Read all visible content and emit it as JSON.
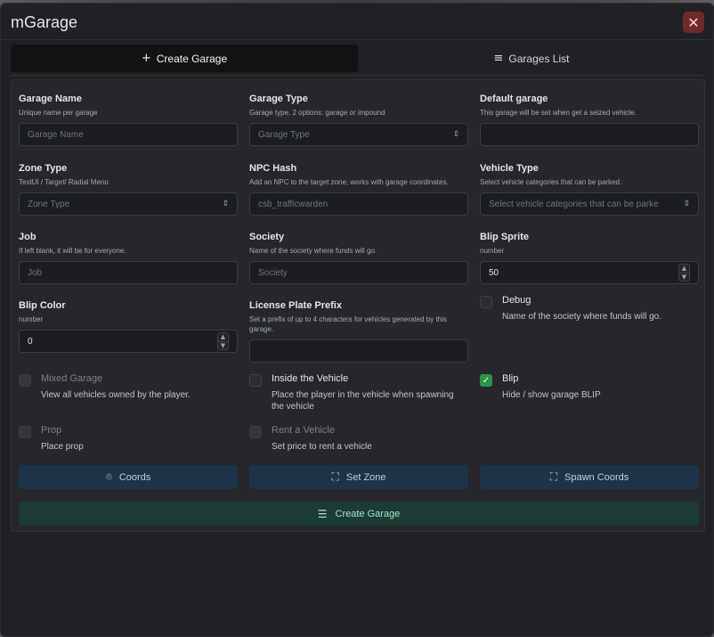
{
  "app": {
    "title": "mGarage",
    "close_icon": "✕"
  },
  "tabs": [
    {
      "label": "Create Garage",
      "icon": "+"
    },
    {
      "label": "Garages List",
      "icon": "≡"
    }
  ],
  "form": {
    "garage_name": {
      "label": "Garage Name",
      "desc": "Unique name per garage",
      "placeholder": "Garage Name"
    },
    "garage_type": {
      "label": "Garage Type",
      "desc": "Garage type, 2 options: garage or impound",
      "placeholder": "Garage Type"
    },
    "default_garage": {
      "label": "Default garage",
      "desc": "This garage will be set when get a seized vehicle.",
      "value": ""
    },
    "zone_type": {
      "label": "Zone Type",
      "desc": "TextUI / Target/ Radial Menu",
      "placeholder": "Zone Type"
    },
    "npc_hash": {
      "label": "NPC Hash",
      "desc": "Add an NPC to the target zone, works with garage coordinates.",
      "placeholder": "csb_trafficwarden"
    },
    "vehicle_type": {
      "label": "Vehicle Type",
      "desc": "Select vehicle categories that can be parked.",
      "placeholder": "Select vehicle categories that can be parke"
    },
    "job": {
      "label": "Job",
      "desc": "If left blank, it will be for everyone.",
      "placeholder": "Job"
    },
    "society": {
      "label": "Society",
      "desc": "Name of the society where funds will go.",
      "placeholder": "Society"
    },
    "blip_sprite": {
      "label": "Blip Sprite",
      "desc": "number",
      "value": "50"
    },
    "blip_color": {
      "label": "Blip Color",
      "desc": "number",
      "value": "0"
    },
    "plate_prefix": {
      "label": "License Plate Prefix",
      "desc": "Set a prefix of up to 4 characters for vehicles generated by this garage.",
      "value": ""
    }
  },
  "checks": {
    "debug": {
      "label": "Debug",
      "desc": "Name of the society where funds will go.",
      "checked": false
    },
    "mixed_garage": {
      "label": "Mixed Garage",
      "desc": "View all vehicles owned by the player.",
      "checked": false
    },
    "inside_vehicle": {
      "label": "Inside the Vehicle",
      "desc": "Place the player in the vehicle when spawning the vehicle",
      "checked": false
    },
    "blip": {
      "label": "Blip",
      "desc": "Hide / show garage BLIP",
      "checked": true
    },
    "prop": {
      "label": "Prop",
      "desc": "Place prop",
      "checked": false
    },
    "rent_vehicle": {
      "label": "Rent a Vehicle",
      "desc": "Set price to rent a vehicle",
      "checked": false
    }
  },
  "actions": {
    "coords": "Coords",
    "set_zone": "Set Zone",
    "spawn_coords": "Spawn Coords",
    "create": "Create Garage"
  },
  "colors": {
    "accent_blue": "#1d3348",
    "accent_green": "#1b3b34",
    "check_green": "#2b9446",
    "close_red": "#6e2a2d"
  }
}
